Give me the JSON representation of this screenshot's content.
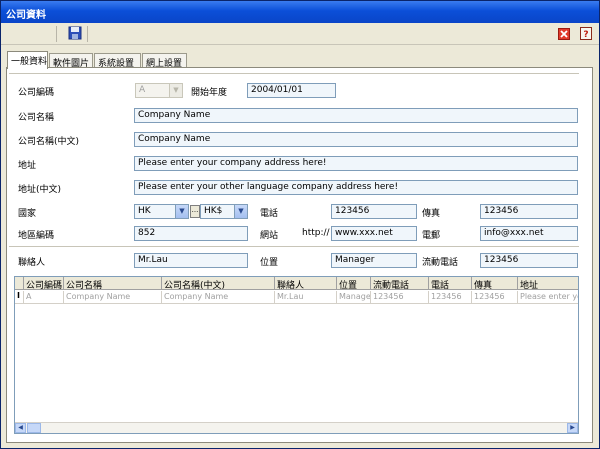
{
  "window": {
    "title": "公司資料"
  },
  "tabs": [
    "一般資料",
    "軟件圖片",
    "系統設置",
    "網上設置"
  ],
  "form": {
    "company_code_label": "公司編碼",
    "company_code_value": "A",
    "start_year_label": "開始年度",
    "start_year_value": "2004/01/01",
    "company_name_label": "公司名稱",
    "company_name_value": "Company Name",
    "company_name_cn_label": "公司名稱(中文)",
    "company_name_cn_value": "Company Name",
    "address_label": "地址",
    "address_value": "Please enter your company address here!",
    "address_cn_label": "地址(中文)",
    "address_cn_value": "Please enter your other language company address here!",
    "country_label": "國家",
    "country_value": "HK",
    "currency_value": "HK$",
    "phone_label": "電話",
    "phone_value": "123456",
    "fax_label": "傳真",
    "fax_value": "123456",
    "area_code_label": "地區編碼",
    "area_code_value": "852",
    "website_label": "網站",
    "website_prefix": "http://",
    "website_value": "www.xxx.net",
    "email_label": "電郵",
    "email_value": "info@xxx.net",
    "contact_label": "聯絡人",
    "contact_value": "Mr.Lau",
    "position_label": "位置",
    "position_value": "Manager",
    "mobile_label": "流動電話",
    "mobile_value": "123456"
  },
  "grid": {
    "headers": [
      "公司編碼",
      "公司名稱",
      "公司名稱(中文)",
      "聯絡人",
      "位置",
      "流動電話",
      "電話",
      "傳真",
      "地址"
    ],
    "row": [
      "A",
      "Company Name",
      "Company Name",
      "Mr.Lau",
      "Manager",
      "123456",
      "123456",
      "123456",
      "Please enter yo"
    ],
    "row_indicator": "I"
  },
  "icons": [
    "save-icon",
    "close-icon",
    "help-icon"
  ]
}
